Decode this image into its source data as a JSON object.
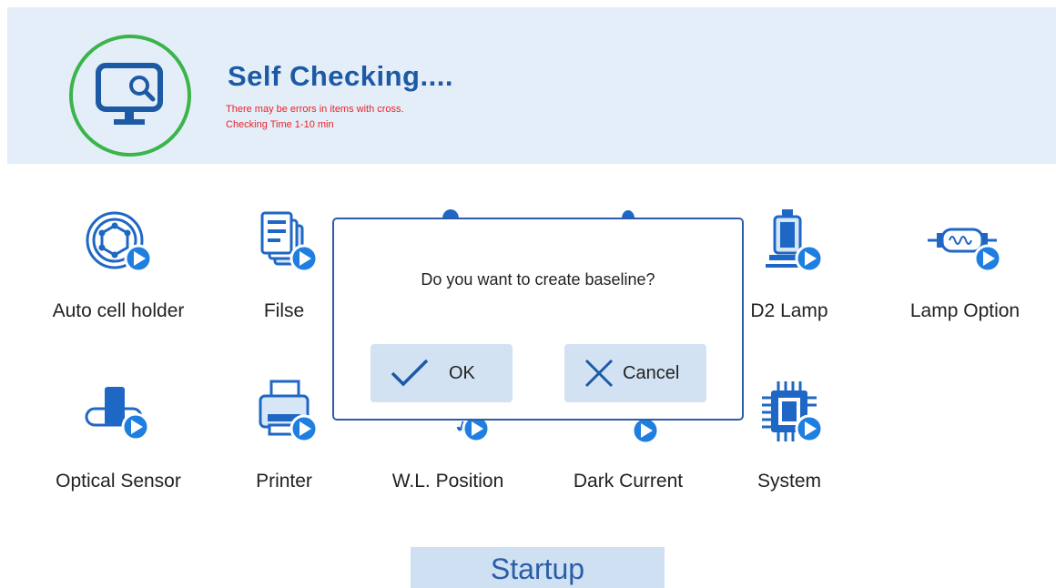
{
  "header": {
    "title": "Self Checking....",
    "warning_line": "There may be errors in items with cross.",
    "time_line": "Checking Time 1-10 min",
    "status_icon": "monitor-search-icon",
    "ring_color": "#3cb44a",
    "title_color": "#1d5aa6",
    "warning_color": "#e8232a"
  },
  "items": [
    {
      "label": "Auto cell holder",
      "icon": "cell-holder-icon"
    },
    {
      "label": "Filse",
      "icon": "files-icon"
    },
    {
      "label": "",
      "icon": "hidden-item-icon"
    },
    {
      "label": "",
      "icon": "hidden-item-icon"
    },
    {
      "label": "D2 Lamp",
      "icon": "d2-lamp-icon"
    },
    {
      "label": "Lamp Option",
      "icon": "lamp-option-icon"
    },
    {
      "label": "Optical Sensor",
      "icon": "optical-sensor-icon"
    },
    {
      "label": "Printer",
      "icon": "printer-icon"
    },
    {
      "label": "W.L. Position",
      "icon": "wavelength-position-icon"
    },
    {
      "label": "Dark Current",
      "icon": "dark-current-icon"
    },
    {
      "label": "System",
      "icon": "chip-icon"
    }
  ],
  "dialog": {
    "question": "Do you want to create baseline?",
    "ok_label": "OK",
    "cancel_label": "Cancel"
  },
  "footer": {
    "startup_label": "Startup"
  },
  "colors": {
    "icon_blue": "#1f67c4",
    "icon_light": "#d7e6f7",
    "play_badge": "#1e7fe0",
    "button_bg": "#d2e2f3"
  }
}
